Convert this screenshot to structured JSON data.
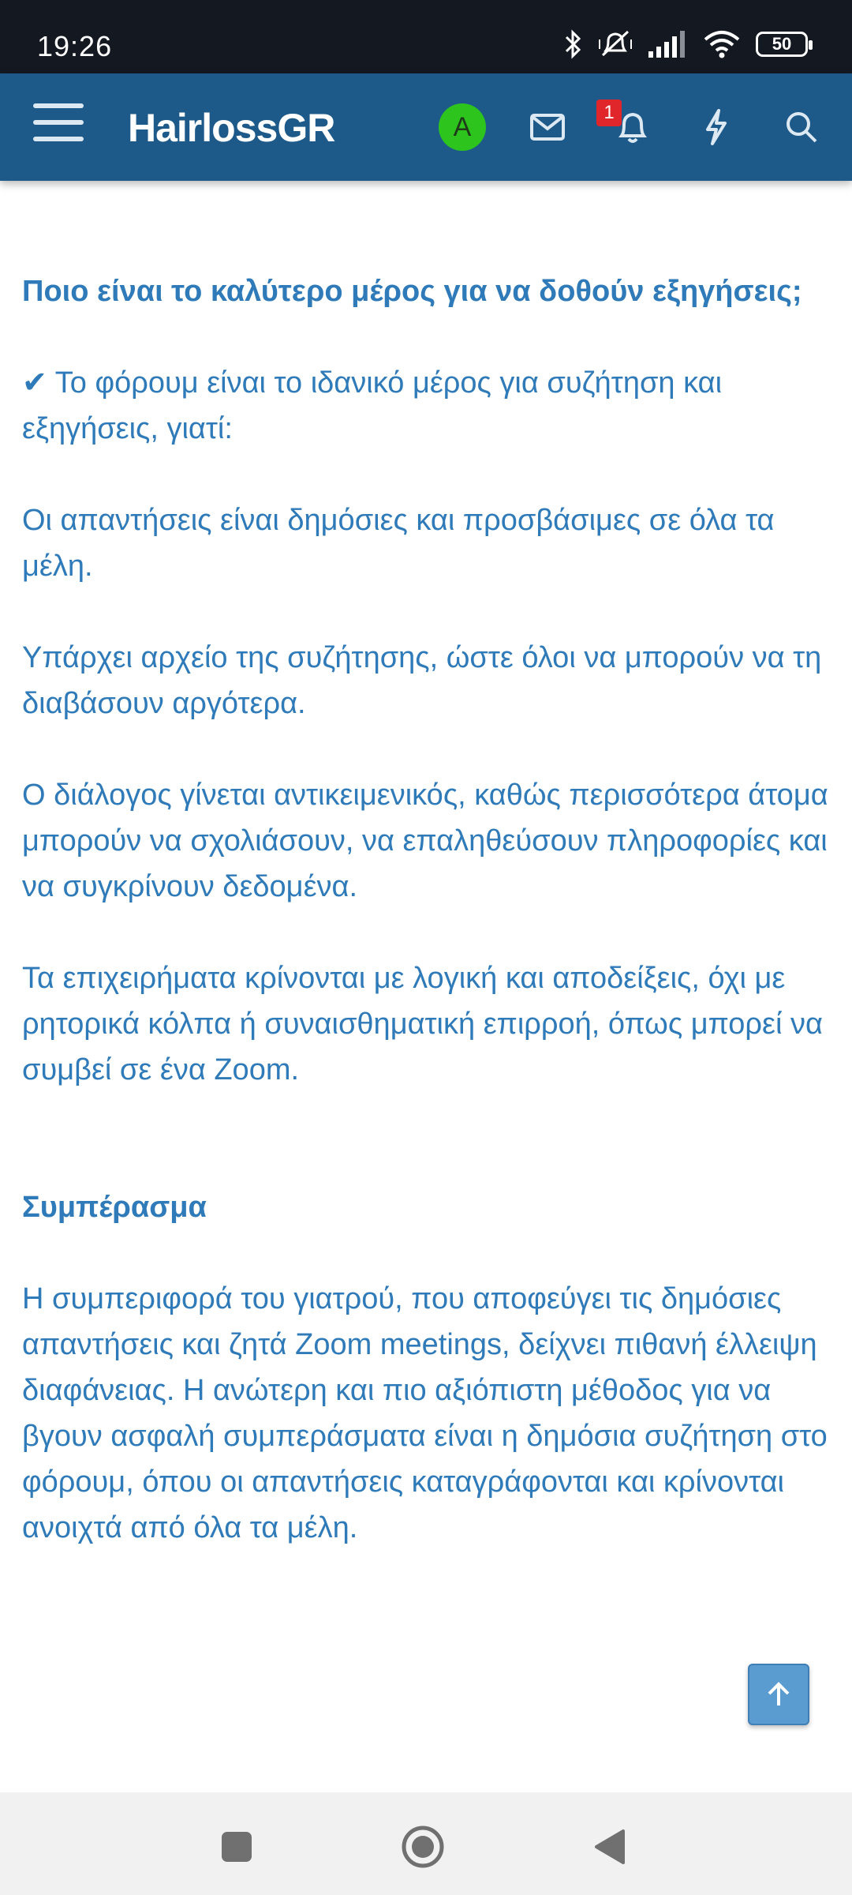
{
  "status_bar": {
    "time": "19:26",
    "battery": "50",
    "icons": [
      "bluetooth-icon",
      "mute-vibrate-icon",
      "signal-icon",
      "wifi-icon",
      "battery-icon"
    ]
  },
  "header": {
    "logo": "HairlossGR",
    "avatar_letter": "A",
    "notification_count": "1",
    "icons": [
      "menu-icon",
      "mail-icon",
      "bell-icon",
      "lightning-icon",
      "search-icon"
    ],
    "colors": {
      "header_bg": "#1d5a8a",
      "avatar_bg": "#2ec41e",
      "badge_bg": "#e0252b"
    }
  },
  "post": {
    "heading1": "Ποιο είναι το καλύτερο μέρος για να δοθούν εξηγήσεις;",
    "intro": "✔ Το φόρουμ είναι το ιδανικό μέρος για συζήτηση και εξηγήσεις, γιατί:",
    "points": [
      "Οι απαντήσεις είναι δημόσιες και προσβάσιμες σε όλα τα μέλη.",
      "Υπάρχει αρχείο της συζήτησης, ώστε όλοι να μπορούν να τη διαβάσουν αργότερα.",
      "Ο διάλογος γίνεται αντικειμενικός, καθώς περισσότερα άτομα μπορούν να σχολιάσουν, να επαληθεύσουν πληροφορίες και να συγκρίνουν δεδομένα.",
      "Τα επιχειρήματα κρίνονται με λογική και αποδείξεις, όχι με ρητορικά κόλπα ή συναισθηματική επιρροή, όπως μπορεί να συμβεί σε ένα Zoom."
    ],
    "heading2": "Συμπέρασμα",
    "conclusion": "Η συμπεριφορά του γιατρού, που αποφεύγει τις δημόσιες απαντήσεις και ζητά Zoom meetings, δείχνει πιθανή έλλειψη διαφάνειας. Η ανώτερη και πιο αξιόπιστη μέθοδος για να βγουν ασφαλή συμπεράσματα είναι η δημόσια συζήτηση στο φόρουμ, όπου οι απαντήσεις καταγράφονται και κρίνονται ανοιχτά από όλα τα μέλη.",
    "text_color": "#2f7ab8"
  },
  "scroll_top_icon": "arrow-up-icon",
  "nav_bar": {
    "icons": [
      "recents-square-icon",
      "home-circle-icon",
      "back-triangle-icon"
    ]
  }
}
